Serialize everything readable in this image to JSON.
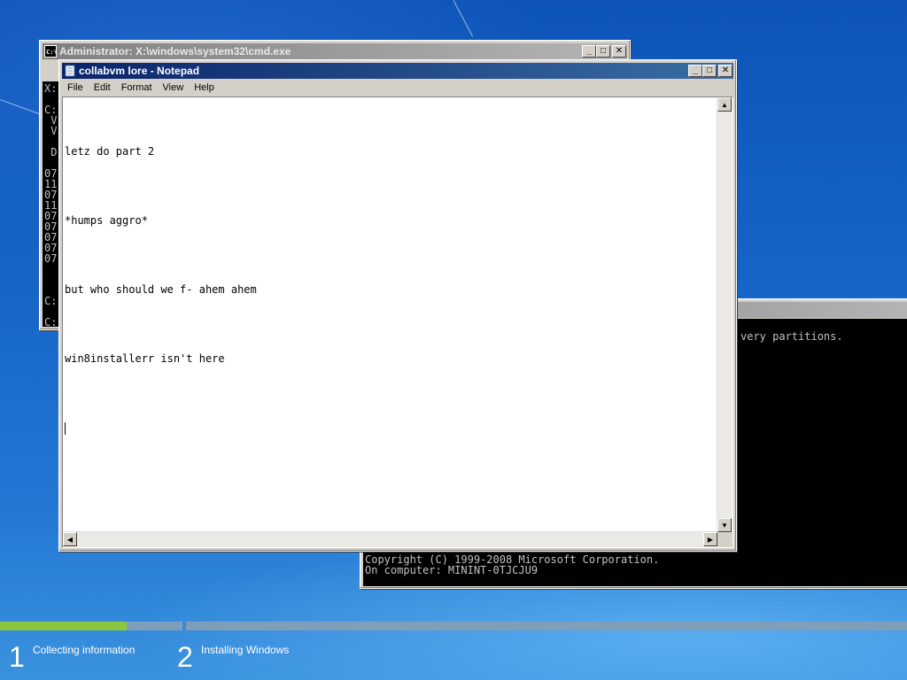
{
  "cmd_back": {
    "title": "Administrator: X:\\windows\\system32\\cmd.exe",
    "lines": [
      "X:",
      "",
      "C:",
      " V",
      " V",
      "",
      " D",
      "",
      "07",
      "11",
      "07",
      "11",
      "07",
      "07",
      "07",
      "07",
      "07",
      "",
      "",
      "",
      "C:",
      "",
      "C:"
    ]
  },
  "cmd_right": {
    "partial_text": "very partitions.",
    "copyright": "Copyright (C) 1999-2008 Microsoft Corporation.",
    "computer": "On computer: MININT-0TJCJU9"
  },
  "notepad": {
    "title": "collabvm lore - Notepad",
    "menu": [
      "File",
      "Edit",
      "Format",
      "View",
      "Help"
    ],
    "lines": [
      "letz do part 2",
      "*humps aggro*",
      "but who should we f- ahem ahem",
      "win8installerr isn't here"
    ]
  },
  "setup": {
    "progress": 0.14,
    "steps": [
      {
        "number": "1",
        "label": "Collecting information"
      },
      {
        "number": "2",
        "label": "Installing Windows"
      }
    ],
    "colors": {
      "progress_fill": "#8cc63f",
      "track": "#7e9fba"
    }
  },
  "icons": {
    "cmd": "console-icon",
    "notepad": "notepad-icon",
    "minimize": "minimize-icon",
    "maximize": "maximize-icon",
    "close": "close-icon"
  }
}
